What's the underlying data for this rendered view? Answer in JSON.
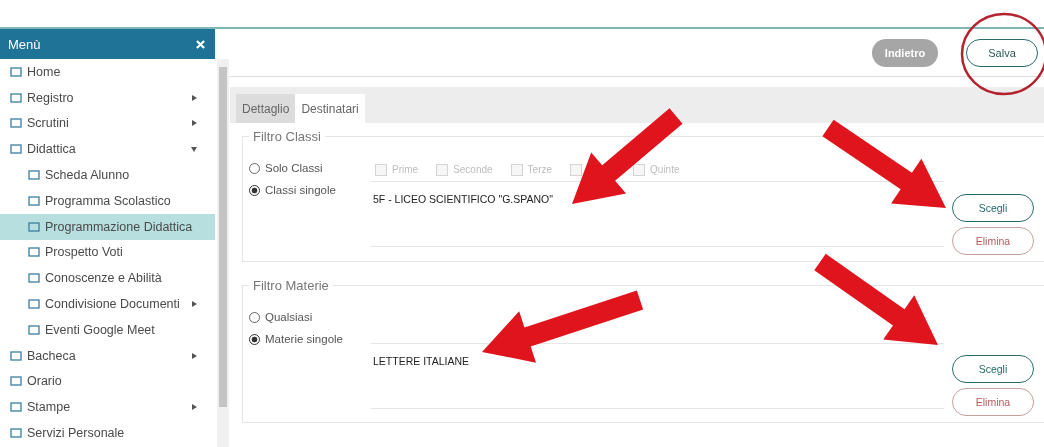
{
  "menu": {
    "title": "Menù",
    "items": [
      {
        "label": "Home",
        "selected": false
      },
      {
        "label": "Registro",
        "selected": false,
        "expanded": false
      },
      {
        "label": "Scrutini",
        "selected": false,
        "expanded": false
      },
      {
        "label": "Didattica",
        "selected": false,
        "expanded": true,
        "children": [
          {
            "label": "Scheda Alunno",
            "selected": false
          },
          {
            "label": "Programma Scolastico",
            "selected": false
          },
          {
            "label": "Programmazione Didattica",
            "selected": true
          },
          {
            "label": "Prospetto Voti",
            "selected": false
          },
          {
            "label": "Conoscenze e Abilità",
            "selected": false
          },
          {
            "label": "Condivisione Documenti",
            "selected": false,
            "expanded": false
          },
          {
            "label": "Eventi Google Meet",
            "selected": false
          }
        ]
      },
      {
        "label": "Bacheca",
        "selected": false,
        "expanded": false
      },
      {
        "label": "Orario",
        "selected": false
      },
      {
        "label": "Stampe",
        "selected": false,
        "expanded": false
      },
      {
        "label": "Servizi Personale",
        "selected": false
      }
    ]
  },
  "toolbar": {
    "back": "Indietro",
    "save": "Salva"
  },
  "tabs": [
    {
      "label": "Dettaglio",
      "selected": false
    },
    {
      "label": "Destinatari",
      "selected": true
    }
  ],
  "filters": [
    {
      "title": "Filtro Classi",
      "options": [
        {
          "label": "Solo Classi",
          "selected": false
        },
        {
          "label": "Classi singole",
          "selected": true
        }
      ],
      "checkboxes": [
        {
          "label": "Prime",
          "checked": false,
          "disabled": true
        },
        {
          "label": "Seconde",
          "checked": false,
          "disabled": true
        },
        {
          "label": "Terze",
          "checked": false,
          "disabled": true
        },
        {
          "checked": false,
          "disabled": true
        },
        {
          "label": "Quinte",
          "checked": false,
          "disabled": true
        }
      ],
      "value": "5F - LICEO SCIENTIFICO \"G.SPANO\"",
      "choose": "Scegli",
      "remove": "Elimina"
    },
    {
      "title": "Filtro Materie",
      "options": [
        {
          "label": "Qualsiasi",
          "selected": false
        },
        {
          "label": "Materie singole",
          "selected": true
        }
      ],
      "value": "LETTERE ITALIANE",
      "choose": "Scegli",
      "remove": "Elimina"
    }
  ]
}
